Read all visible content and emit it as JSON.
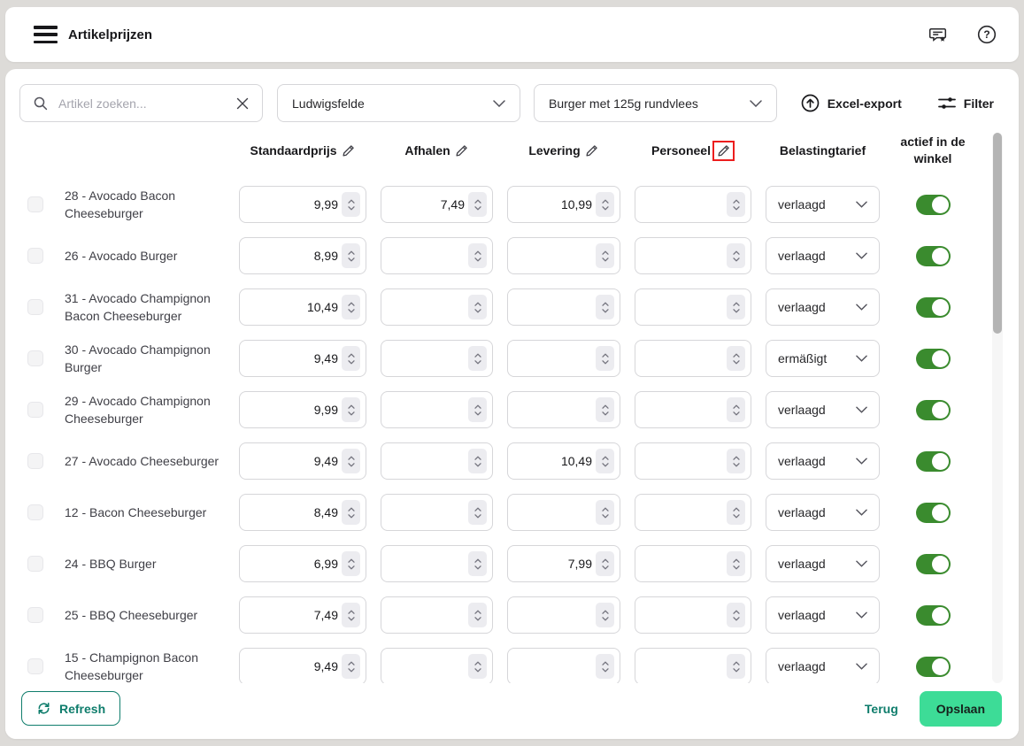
{
  "topbar": {
    "title": "Artikelprijzen",
    "icons": [
      "hamburger-menu",
      "feedback-message-star",
      "help-circle"
    ]
  },
  "toolbar": {
    "search": {
      "placeholder": "Artikel zoeken...",
      "value": "",
      "icons": [
        "search",
        "clear-x"
      ]
    },
    "location_select": {
      "value": "Ludwigsfelde"
    },
    "category_select": {
      "value": "Burger met 125g rundvlees"
    },
    "export_label": "Excel-export",
    "filter_label": "Filter",
    "icons": [
      "upload-circle",
      "filter-sliders"
    ]
  },
  "table": {
    "columns": [
      {
        "label": "Standaardprijs",
        "editable": true
      },
      {
        "label": "Afhalen",
        "editable": true
      },
      {
        "label": "Levering",
        "editable": true
      },
      {
        "label": "Personeel",
        "editable": true,
        "annotated": true
      },
      {
        "label": "Belastingtarief",
        "editable": false
      },
      {
        "label": "actief in de winkel",
        "editable": false
      }
    ],
    "rows": [
      {
        "name": "28 - Avocado Bacon Cheeseburger",
        "standard": "9,99",
        "pickup": "7,49",
        "delivery": "10,99",
        "staff": "",
        "tax": "verlaagd",
        "active": true
      },
      {
        "name": "26 - Avocado Burger",
        "standard": "8,99",
        "pickup": "",
        "delivery": "",
        "staff": "",
        "tax": "verlaagd",
        "active": true
      },
      {
        "name": "31 - Avocado Champignon Bacon Cheeseburger",
        "standard": "10,49",
        "pickup": "",
        "delivery": "",
        "staff": "",
        "tax": "verlaagd",
        "active": true
      },
      {
        "name": "30 - Avocado Champignon Burger",
        "standard": "9,49",
        "pickup": "",
        "delivery": "",
        "staff": "",
        "tax": "ermäßigt",
        "active": true
      },
      {
        "name": "29 - Avocado Champignon Cheeseburger",
        "standard": "9,99",
        "pickup": "",
        "delivery": "",
        "staff": "",
        "tax": "verlaagd",
        "active": true
      },
      {
        "name": "27 - Avocado Cheeseburger",
        "standard": "9,49",
        "pickup": "",
        "delivery": "10,49",
        "staff": "",
        "tax": "verlaagd",
        "active": true
      },
      {
        "name": "12 - Bacon Cheeseburger",
        "standard": "8,49",
        "pickup": "",
        "delivery": "",
        "staff": "",
        "tax": "verlaagd",
        "active": true
      },
      {
        "name": "24 - BBQ Burger",
        "standard": "6,99",
        "pickup": "",
        "delivery": "7,99",
        "staff": "",
        "tax": "verlaagd",
        "active": true
      },
      {
        "name": "25 - BBQ Cheeseburger",
        "standard": "7,49",
        "pickup": "",
        "delivery": "",
        "staff": "",
        "tax": "verlaagd",
        "active": true
      },
      {
        "name": "15 - Champignon Bacon Cheeseburger",
        "standard": "9,49",
        "pickup": "",
        "delivery": "",
        "staff": "",
        "tax": "verlaagd",
        "active": true
      }
    ]
  },
  "footer": {
    "refresh_label": "Refresh",
    "back_label": "Terug",
    "save_label": "Opslaan"
  },
  "colors": {
    "accent_teal": "#0f7d6c",
    "toggle_green": "#3a8b2e",
    "save_green": "#3ddc97",
    "annotation_red": "#ec1e1e",
    "page_background": "#dddbd8"
  }
}
